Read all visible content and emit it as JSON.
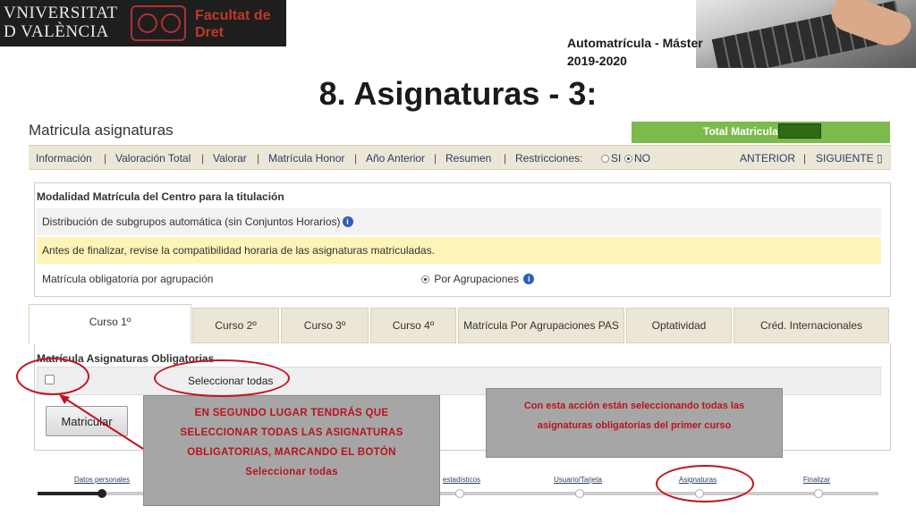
{
  "header": {
    "logo_line1": "VNIVERSITAT",
    "logo_line2": "D VALÈNCIA",
    "faculty_line1": "Facultat de",
    "faculty_line2": "Dret",
    "subtitle_line1": "Automatrícula - Máster",
    "subtitle_line2": "2019-2020",
    "slide_title": "8. Asignaturas - 3:"
  },
  "app": {
    "title": "Matricula asignaturas",
    "total_label": "Total Matriculado",
    "nav": {
      "informacion": "Información",
      "valoracion_total": "Valoración Total",
      "valorar": "Valorar",
      "matricula_honor": "Matrícula Honor",
      "ano_anterior": "Año Anterior",
      "resumen": "Resumen",
      "restricciones": "Restricciones:",
      "si": "SI",
      "no": "NO",
      "anterior": "ANTERIOR",
      "siguiente": "SIGUIENTE"
    },
    "modalidad": {
      "heading": "Modalidad Matrícula del Centro para la titulación",
      "distribucion": "Distribución de subgrupos automática (sin Conjuntos Horarios)",
      "aviso": "Antes de finalizar, revise la compatibilidad horaria de las asignaturas matriculadas.",
      "obligatoria": "Matrícula obligatoria por agrupación",
      "por_agrupaciones": "Por Agrupaciones"
    },
    "tabs": [
      "Curso 1º",
      "Curso 2º",
      "Curso 3º",
      "Curso 4º",
      "Matrícula Por Agrupaciones PAS",
      "Optatividad",
      "Créd. Internacionales"
    ],
    "section_title": "Matrícula Asignaturas Obligatorias",
    "select_all": "Seleccionar todas",
    "matricular": "Matricular",
    "steps": [
      "Datos personales",
      "estadísticos",
      "Usuario/Tarjeta",
      "Asignaturas",
      "Finalizar"
    ]
  },
  "annotations": {
    "left_callout": [
      "EN SEGUNDO LUGAR TENDRÁS QUE",
      "SELECCIONAR TODAS LAS ASIGNATURAS",
      "OBLIGATORIAS, MARCANDO EL BOTÓN",
      "Seleccionar todas"
    ],
    "right_callout": [
      "Con esta acción están seleccionando todas las",
      "asignaturas obligatorias del primer curso"
    ]
  },
  "colors": {
    "accent_green": "#7cba4c",
    "highlight_red": "#c0141e",
    "callout_gray": "#a6a6a6",
    "warning_yellow": "#fdf4b7"
  }
}
